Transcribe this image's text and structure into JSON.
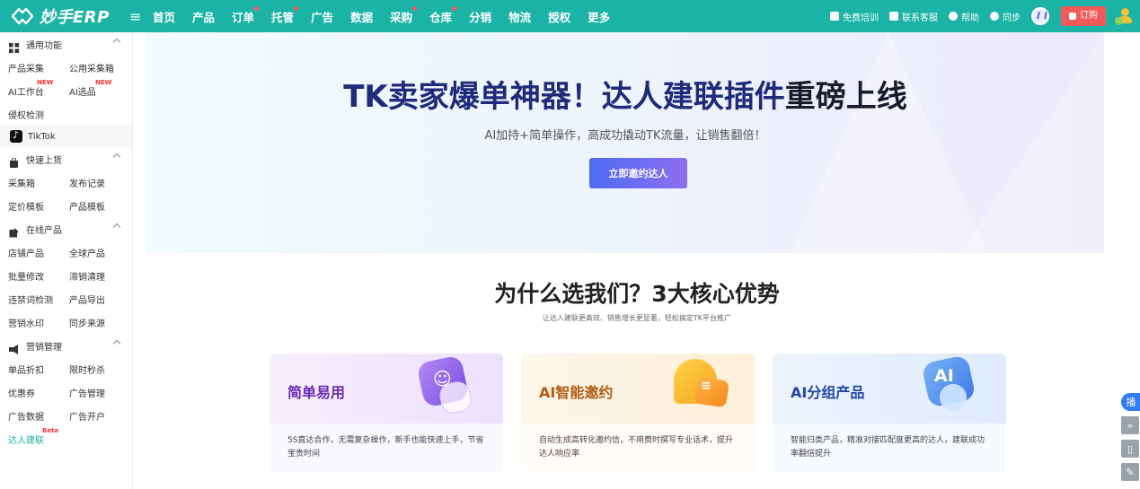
{
  "app": {
    "logo_text": "妙手ERP",
    "brand_color": "#1ab3a6"
  },
  "nav": {
    "items": [
      {
        "label": "首页",
        "dot": false
      },
      {
        "label": "产品",
        "dot": false
      },
      {
        "label": "订单",
        "dot": true
      },
      {
        "label": "托管",
        "dot": true
      },
      {
        "label": "广告",
        "dot": false
      },
      {
        "label": "数据",
        "dot": false
      },
      {
        "label": "采购",
        "dot": true
      },
      {
        "label": "仓库",
        "dot": true
      },
      {
        "label": "分销",
        "dot": false
      },
      {
        "label": "物流",
        "dot": false
      },
      {
        "label": "授权",
        "dot": false
      },
      {
        "label": "更多",
        "dot": false
      }
    ]
  },
  "topright": {
    "training": "免费培训",
    "service": "联系客服",
    "help": "帮助",
    "sync": "同步",
    "order": "订购"
  },
  "sidebar": {
    "general": {
      "title": "通用功能",
      "links": [
        {
          "label": "产品采集"
        },
        {
          "label": "公用采集箱"
        },
        {
          "label": "AI工作台",
          "badge": "NEW"
        },
        {
          "label": "AI选品",
          "badge": "NEW"
        },
        {
          "label": "侵权检测"
        }
      ]
    },
    "tiktok": "TikTok",
    "quick_listing": {
      "title": "快速上货",
      "links": [
        {
          "label": "采集箱"
        },
        {
          "label": "发布记录"
        },
        {
          "label": "定价模板"
        },
        {
          "label": "产品模板"
        }
      ]
    },
    "online_products": {
      "title": "在线产品",
      "links": [
        {
          "label": "店铺产品"
        },
        {
          "label": "全球产品"
        },
        {
          "label": "批量修改"
        },
        {
          "label": "滞销清理"
        },
        {
          "label": "违禁词检测"
        },
        {
          "label": "产品导出"
        },
        {
          "label": "营销水印"
        },
        {
          "label": "同步来源"
        }
      ]
    },
    "marketing": {
      "title": "营销管理",
      "links": [
        {
          "label": "单品折扣"
        },
        {
          "label": "限时秒杀"
        },
        {
          "label": "优惠券"
        },
        {
          "label": "广告管理"
        },
        {
          "label": "广告数据"
        },
        {
          "label": "广告开户"
        },
        {
          "label": "达人建联",
          "badge": "Beta",
          "active": true
        }
      ]
    }
  },
  "hero": {
    "title_highlight": "TK卖家爆单神器！达人建联插件",
    "title_rest": "重磅上线",
    "subtitle": "AI加持+简单操作，高成功撬动TK流量，让销售翻倍！",
    "button": "立即邀约达人"
  },
  "why": {
    "title": "为什么选我们？3大核心优势",
    "subtitle": "让达人建联更高效、销售增长更显著，轻松搞定TK平台推广"
  },
  "cards": [
    {
      "title": "简单易用",
      "desc": "5S直达合作，无需复杂操作，新手也能快速上手，节省宝贵时间",
      "icon": "smile-box-icon"
    },
    {
      "title": "AI智能邀约",
      "desc": "自动生成高转化邀约信，不用费时撰写专业话术，提升达人响应率",
      "icon": "chat-bubble-icon"
    },
    {
      "title": "AI分组产品",
      "desc": "智能归类产品，精准对接匹配度更高的达人，建联成功率翻倍提升",
      "icon": "ai-box-icon"
    }
  ],
  "float_tools": {
    "first": "播"
  }
}
